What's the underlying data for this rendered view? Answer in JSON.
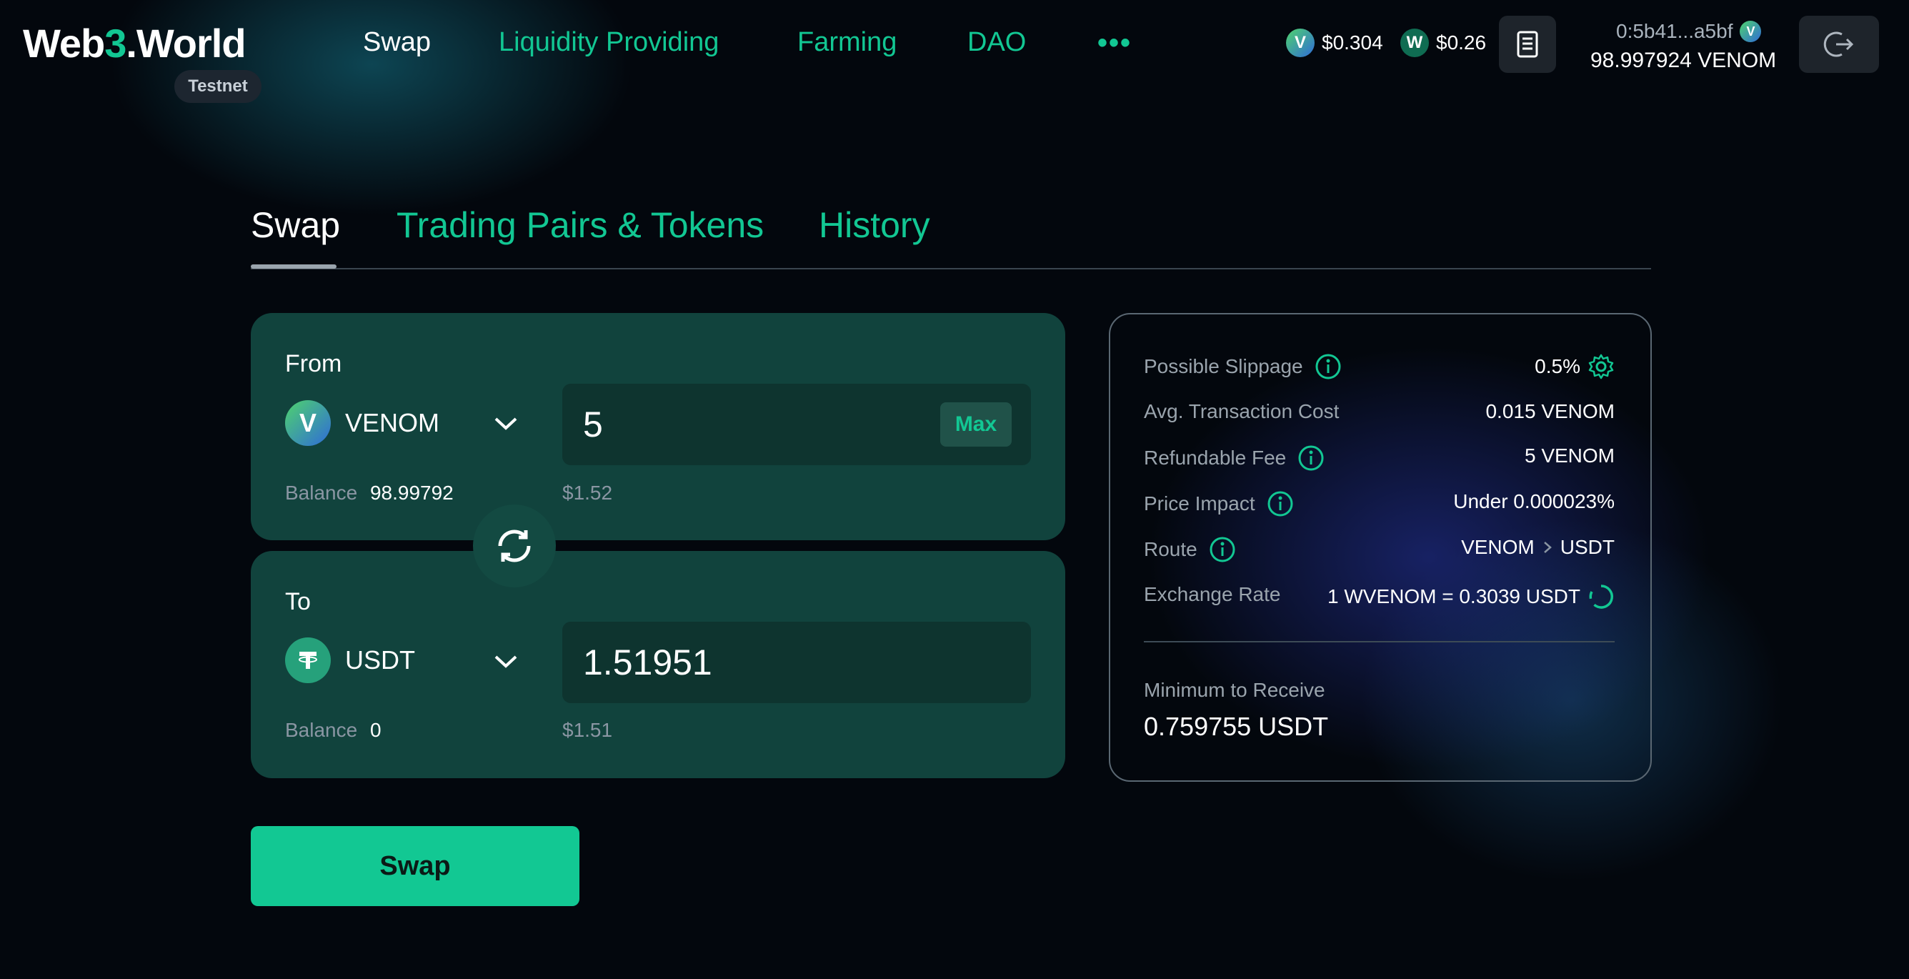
{
  "header": {
    "logo_web": "We",
    "logo_b": "b",
    "logo_three": "3",
    "logo_world": ".World",
    "testnet_label": "Testnet",
    "nav": [
      "Swap",
      "Liquidity Providing",
      "Farming",
      "DAO"
    ],
    "more_label": "•••",
    "prices": [
      {
        "symbol": "V",
        "value": "$0.304",
        "color": "#2f8fd8"
      },
      {
        "symbol": "W",
        "value": "$0.26",
        "color": "#0f6c52"
      }
    ],
    "wallet_address": "0:5b41...a5bf",
    "wallet_balance": "98.997924 VENOM"
  },
  "tabs": [
    "Swap",
    "Trading Pairs & Tokens",
    "History"
  ],
  "from": {
    "label": "From",
    "token": "VENOM",
    "amount": "5",
    "max_label": "Max",
    "balance_label": "Balance",
    "balance": "98.99792",
    "usd": "$1.52"
  },
  "to": {
    "label": "To",
    "token": "USDT",
    "amount": "1.51951",
    "balance_label": "Balance",
    "balance": "0",
    "usd": "$1.51"
  },
  "info": {
    "slippage_label": "Possible Slippage",
    "slippage_value": "0.5%",
    "avg_cost_label": "Avg. Transaction Cost",
    "avg_cost_value": "0.015 VENOM",
    "refundable_label": "Refundable Fee",
    "refundable_value": "5 VENOM",
    "impact_label": "Price Impact",
    "impact_value": "Under 0.000023%",
    "route_label": "Route",
    "route_from": "VENOM",
    "route_to": "USDT",
    "rate_label": "Exchange Rate",
    "rate_value": "1 WVENOM = 0.3039 USDT",
    "min_label": "Minimum to Receive",
    "min_value": "0.759755 USDT"
  },
  "swap_button": "Swap",
  "colors": {
    "accent": "#12c793",
    "card": "#11433d",
    "background": "#03070d"
  }
}
